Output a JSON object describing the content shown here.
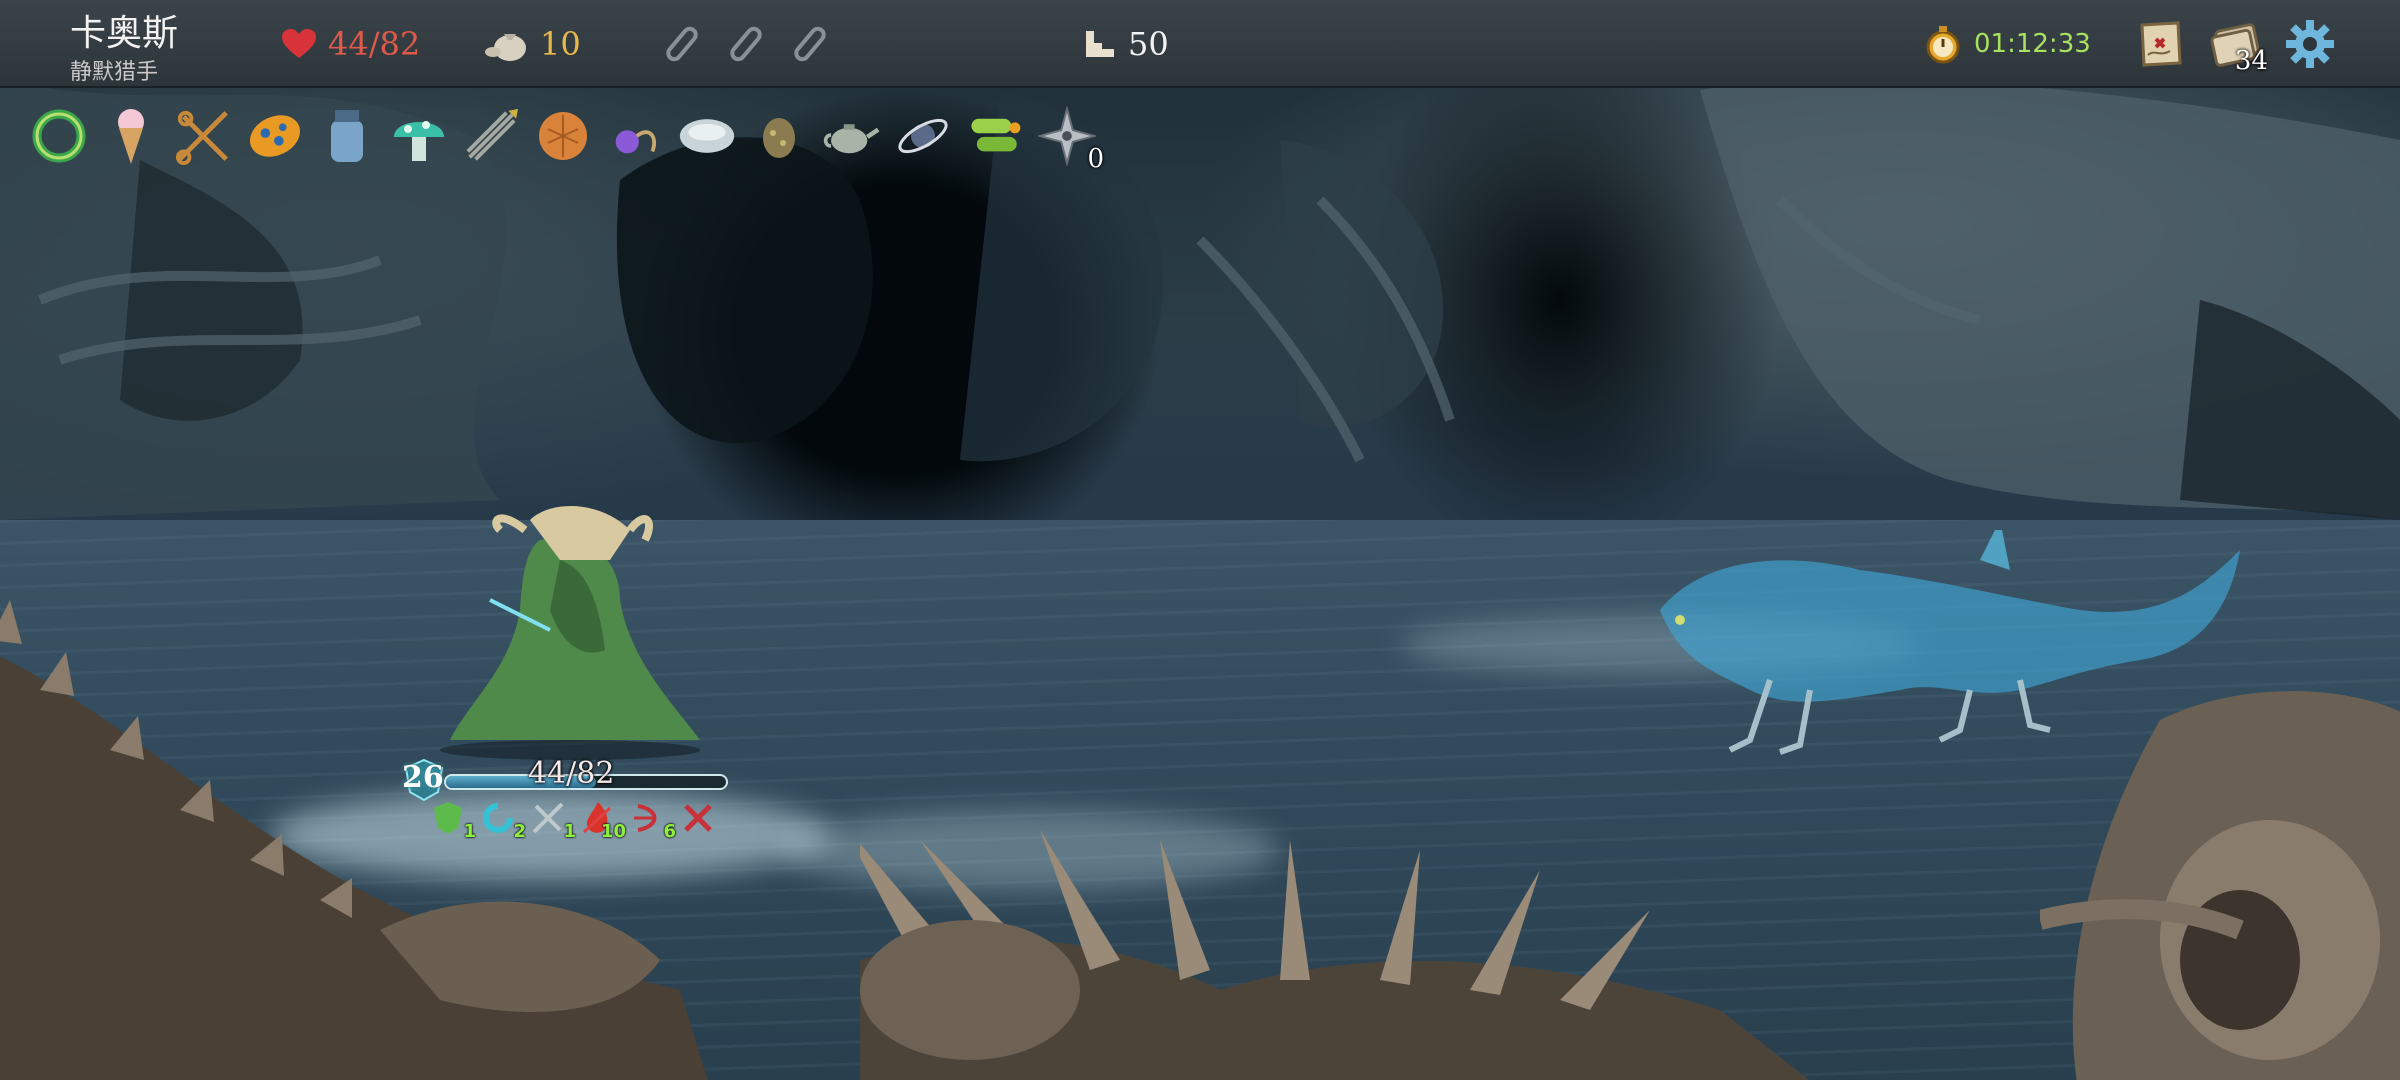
{
  "character": {
    "name": "卡奥斯",
    "class": "静默猎手"
  },
  "hud": {
    "hp": "44/82",
    "gold": "10",
    "potion_slots": [
      "empty-potion-slot-icon",
      "empty-potion-slot-icon",
      "empty-potion-slot-icon"
    ],
    "depth": "50",
    "timer": "01:12:33",
    "deck_count": "34"
  },
  "relics": [
    {
      "icon": "green-ring-icon"
    },
    {
      "icon": "ice-cream-icon"
    },
    {
      "icon": "crossed-scissors-icon"
    },
    {
      "icon": "blue-orange-egg-icon"
    },
    {
      "icon": "jar-icon"
    },
    {
      "icon": "mushroom-icon"
    },
    {
      "icon": "bundle-of-arrows-icon"
    },
    {
      "icon": "biscuit-icon"
    },
    {
      "icon": "purple-pendant-icon"
    },
    {
      "icon": "white-stone-icon"
    },
    {
      "icon": "egg-icon"
    },
    {
      "icon": "teapot-icon"
    },
    {
      "icon": "orbit-orb-icon"
    },
    {
      "icon": "scroll-stack-icon"
    },
    {
      "icon": "shuriken-icon",
      "count": "0"
    }
  ],
  "player": {
    "block_level": "26",
    "hp_text": "44/82",
    "hp_fraction": 0.537,
    "buffs": [
      {
        "icon": "shield-buff-icon",
        "value": "1",
        "color": "#5dbb4c"
      },
      {
        "icon": "swirl-buff-icon",
        "value": "2",
        "color": "#35c2d6"
      },
      {
        "icon": "dagger-buff-icon",
        "value": "1",
        "color": "#bfc8cc"
      },
      {
        "icon": "flame-buff-icon",
        "value": "10",
        "color": "#d8342c"
      },
      {
        "icon": "bow-debuff-icon",
        "value": "6",
        "color": "#c8303a"
      },
      {
        "icon": "cross-debuff-icon",
        "value": "",
        "color": "#c8303a"
      }
    ]
  },
  "colors": {
    "hp_red": "#e05a4a",
    "gold": "#e8b94a",
    "timer_green": "#a8e060",
    "buff_number": "#8ef03c"
  }
}
